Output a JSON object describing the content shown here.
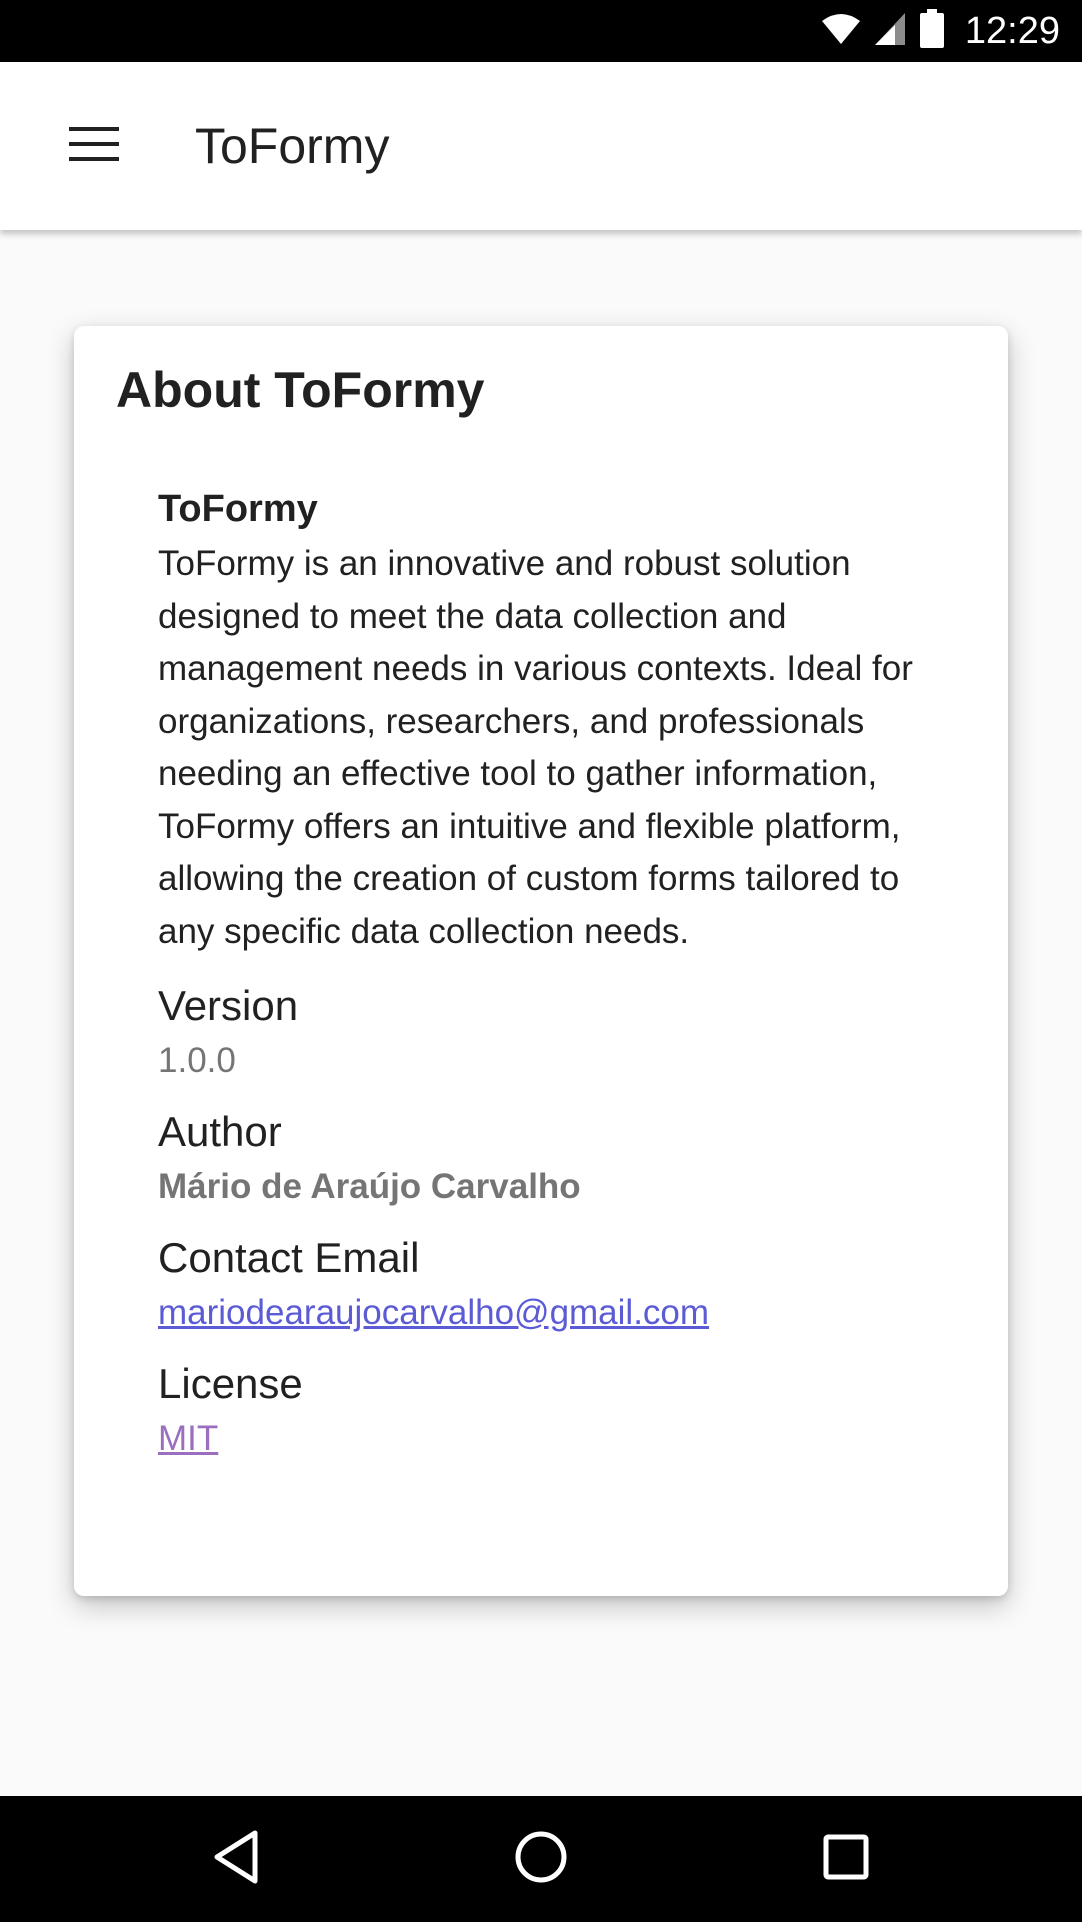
{
  "status_bar": {
    "time": "12:29",
    "icons": [
      "wifi-icon",
      "cell-signal-icon",
      "battery-icon"
    ]
  },
  "app_bar": {
    "menu_icon": "menu-icon",
    "title": "ToFormy"
  },
  "about_card": {
    "title": "About ToFormy",
    "app_name": "ToFormy",
    "description": "ToFormy is an innovative and robust solution designed to meet the data collection and management needs in various contexts. Ideal for organizations, researchers, and professionals needing an effective tool to gather information, ToFormy offers an intuitive and flexible platform, allowing the creation of custom forms tailored to any specific data collection needs.",
    "version": {
      "label": "Version",
      "value": "1.0.0"
    },
    "author": {
      "label": "Author",
      "value": "Mário de Araújo Carvalho"
    },
    "contact": {
      "label": "Contact Email",
      "value": "mariodearaujocarvalho@gmail.com"
    },
    "license": {
      "label": "License",
      "value": "MIT"
    }
  },
  "nav_bar": {
    "icons": [
      "back-icon",
      "home-icon",
      "recents-icon"
    ]
  },
  "colors": {
    "background": "#fafafa",
    "link": "#5b5bd6",
    "visited_link": "#9a6fbf",
    "secondary_text": "#757575"
  }
}
